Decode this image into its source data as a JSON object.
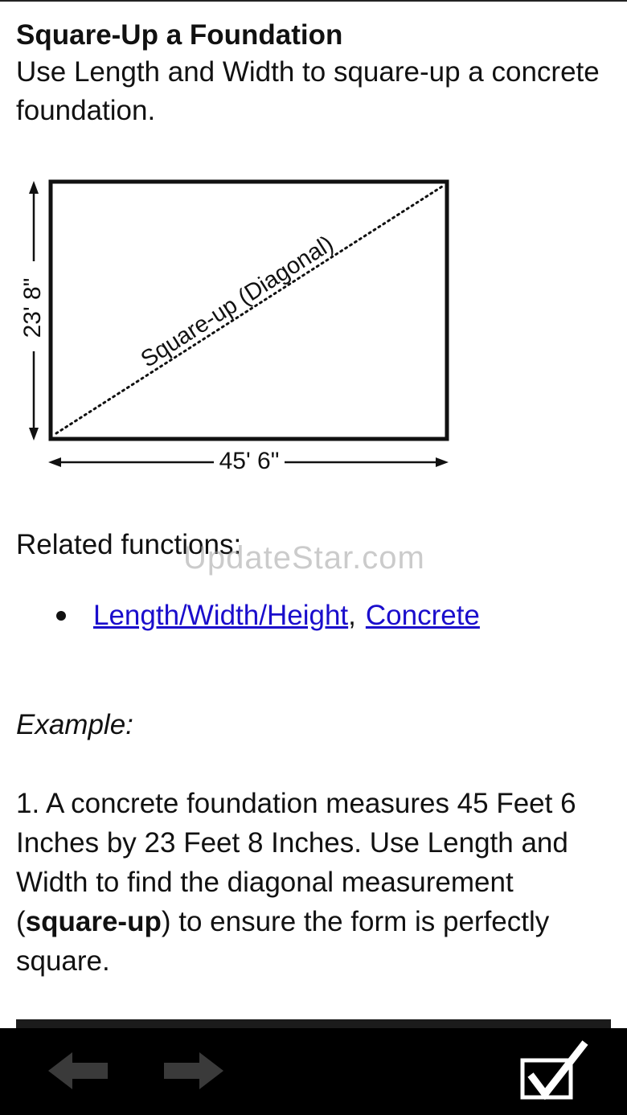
{
  "header": {
    "title": "Square-Up a Foundation",
    "subtitle": "Use Length and Width to square-up a concrete foundation."
  },
  "diagram": {
    "height_label": "23' 8\"",
    "width_label": "45' 6\"",
    "diagonal_label": "Square-up (Diagonal)"
  },
  "related": {
    "label": "Related functions:",
    "links": [
      {
        "label": "Length/Width/Height"
      },
      {
        "label": "Concrete"
      }
    ],
    "separator": ","
  },
  "watermark": "UpdateStar.com",
  "example": {
    "label": "Example:",
    "text_before": "1. A concrete foundation measures 45 Feet 6 Inches by 23 Feet 8 Inches. Use Length and Width to find the diagonal measurement (",
    "bold": "square-up",
    "text_after": ") to ensure the form is perfectly square."
  },
  "toolbar": {
    "back_icon": "arrow-left-icon",
    "forward_icon": "arrow-right-icon",
    "done_icon": "checkbox-check-icon",
    "colors": {
      "background": "#000000",
      "disabled_arrow": "#3a3a3a",
      "check": "#ffffff"
    }
  }
}
